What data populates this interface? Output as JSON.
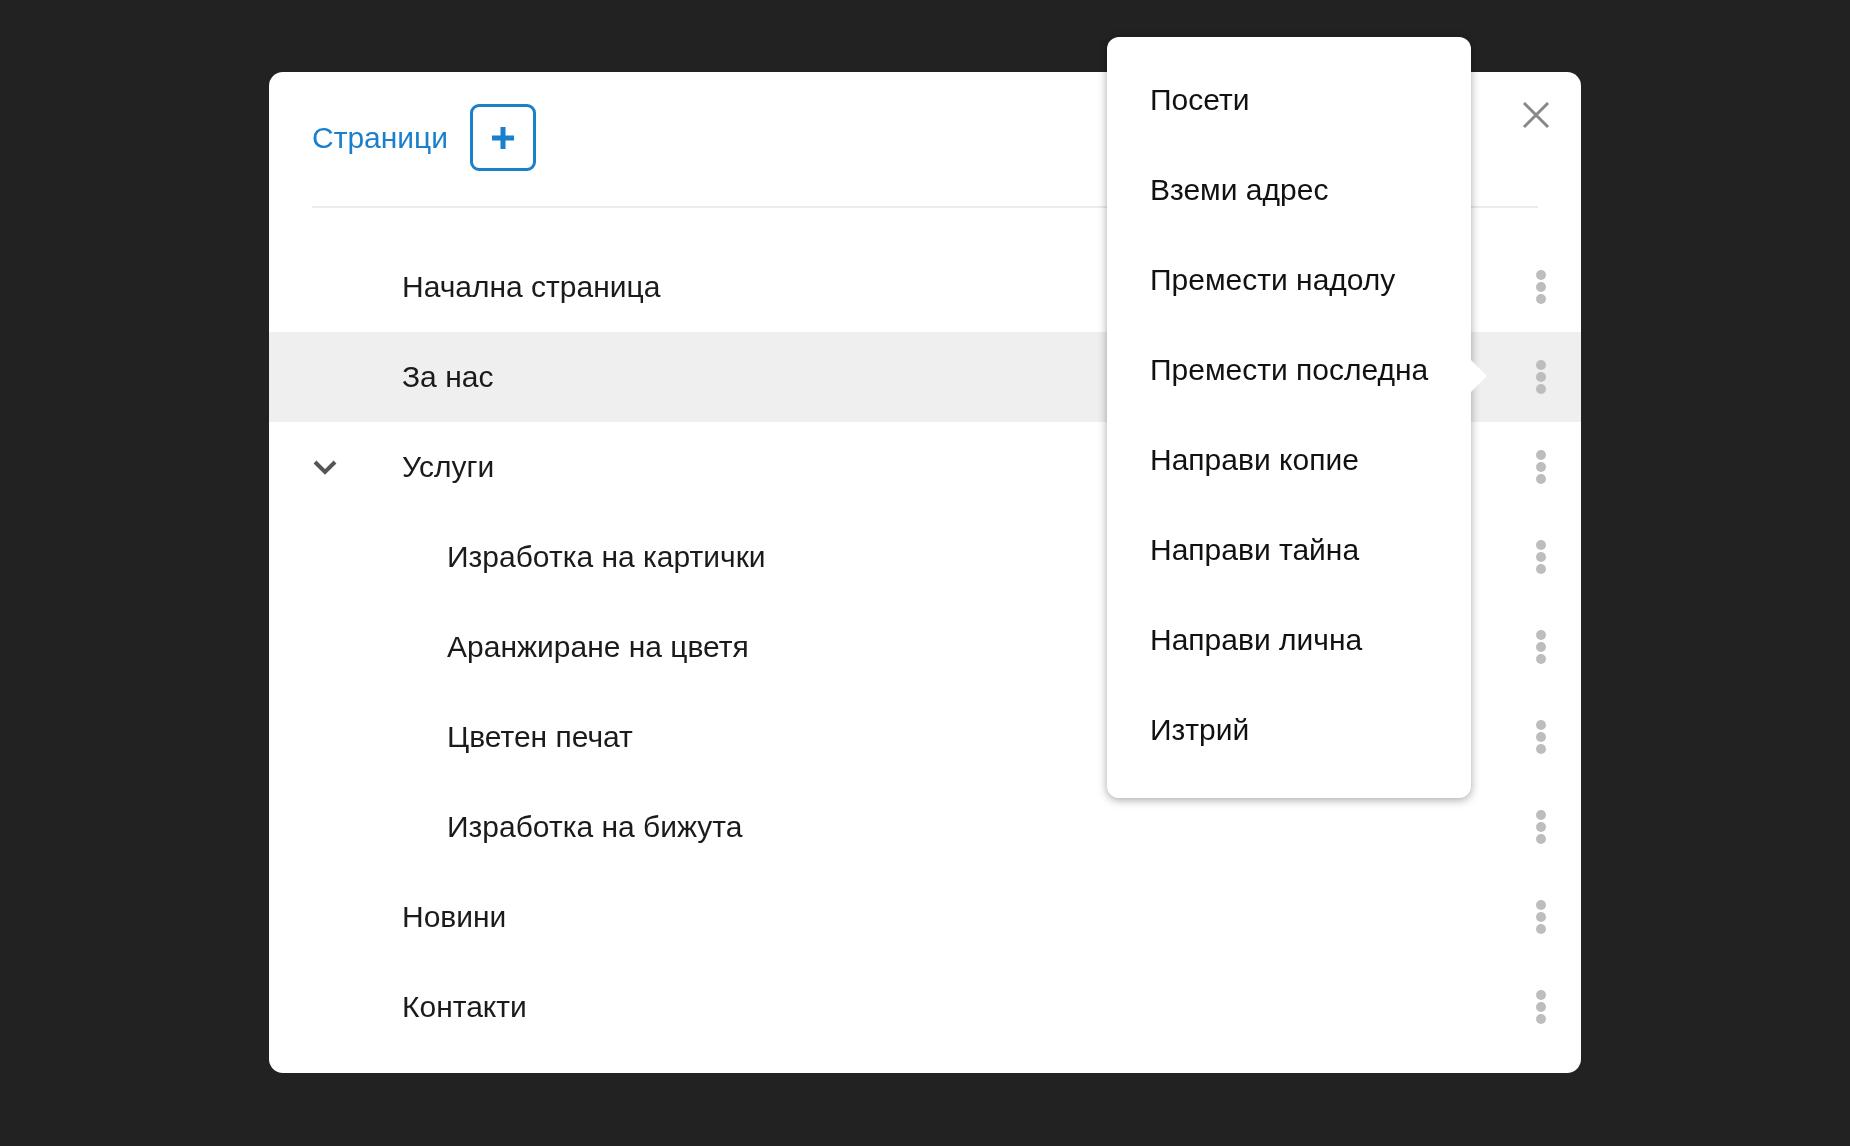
{
  "dialog": {
    "title": "Страници",
    "pages": [
      {
        "label": "Начална страница",
        "selected": false
      },
      {
        "label": "За нас",
        "selected": true
      },
      {
        "label": "Услуги",
        "selected": false,
        "expanded": true,
        "children": [
          {
            "label": "Изработка на картички",
            "selected": false
          },
          {
            "label": "Аранжиране на цветя",
            "selected": false
          },
          {
            "label": "Цветен печат",
            "selected": false
          },
          {
            "label": "Изработка на бижута",
            "selected": false
          }
        ]
      },
      {
        "label": "Новини",
        "selected": false
      },
      {
        "label": "Контакти",
        "selected": false
      }
    ]
  },
  "context_menu": {
    "items": [
      "Посети",
      "Вземи адрес",
      "Премести надолу",
      "Премести последна",
      "Направи копие",
      "Направи тайна",
      "Направи лична",
      "Изтрий"
    ]
  }
}
